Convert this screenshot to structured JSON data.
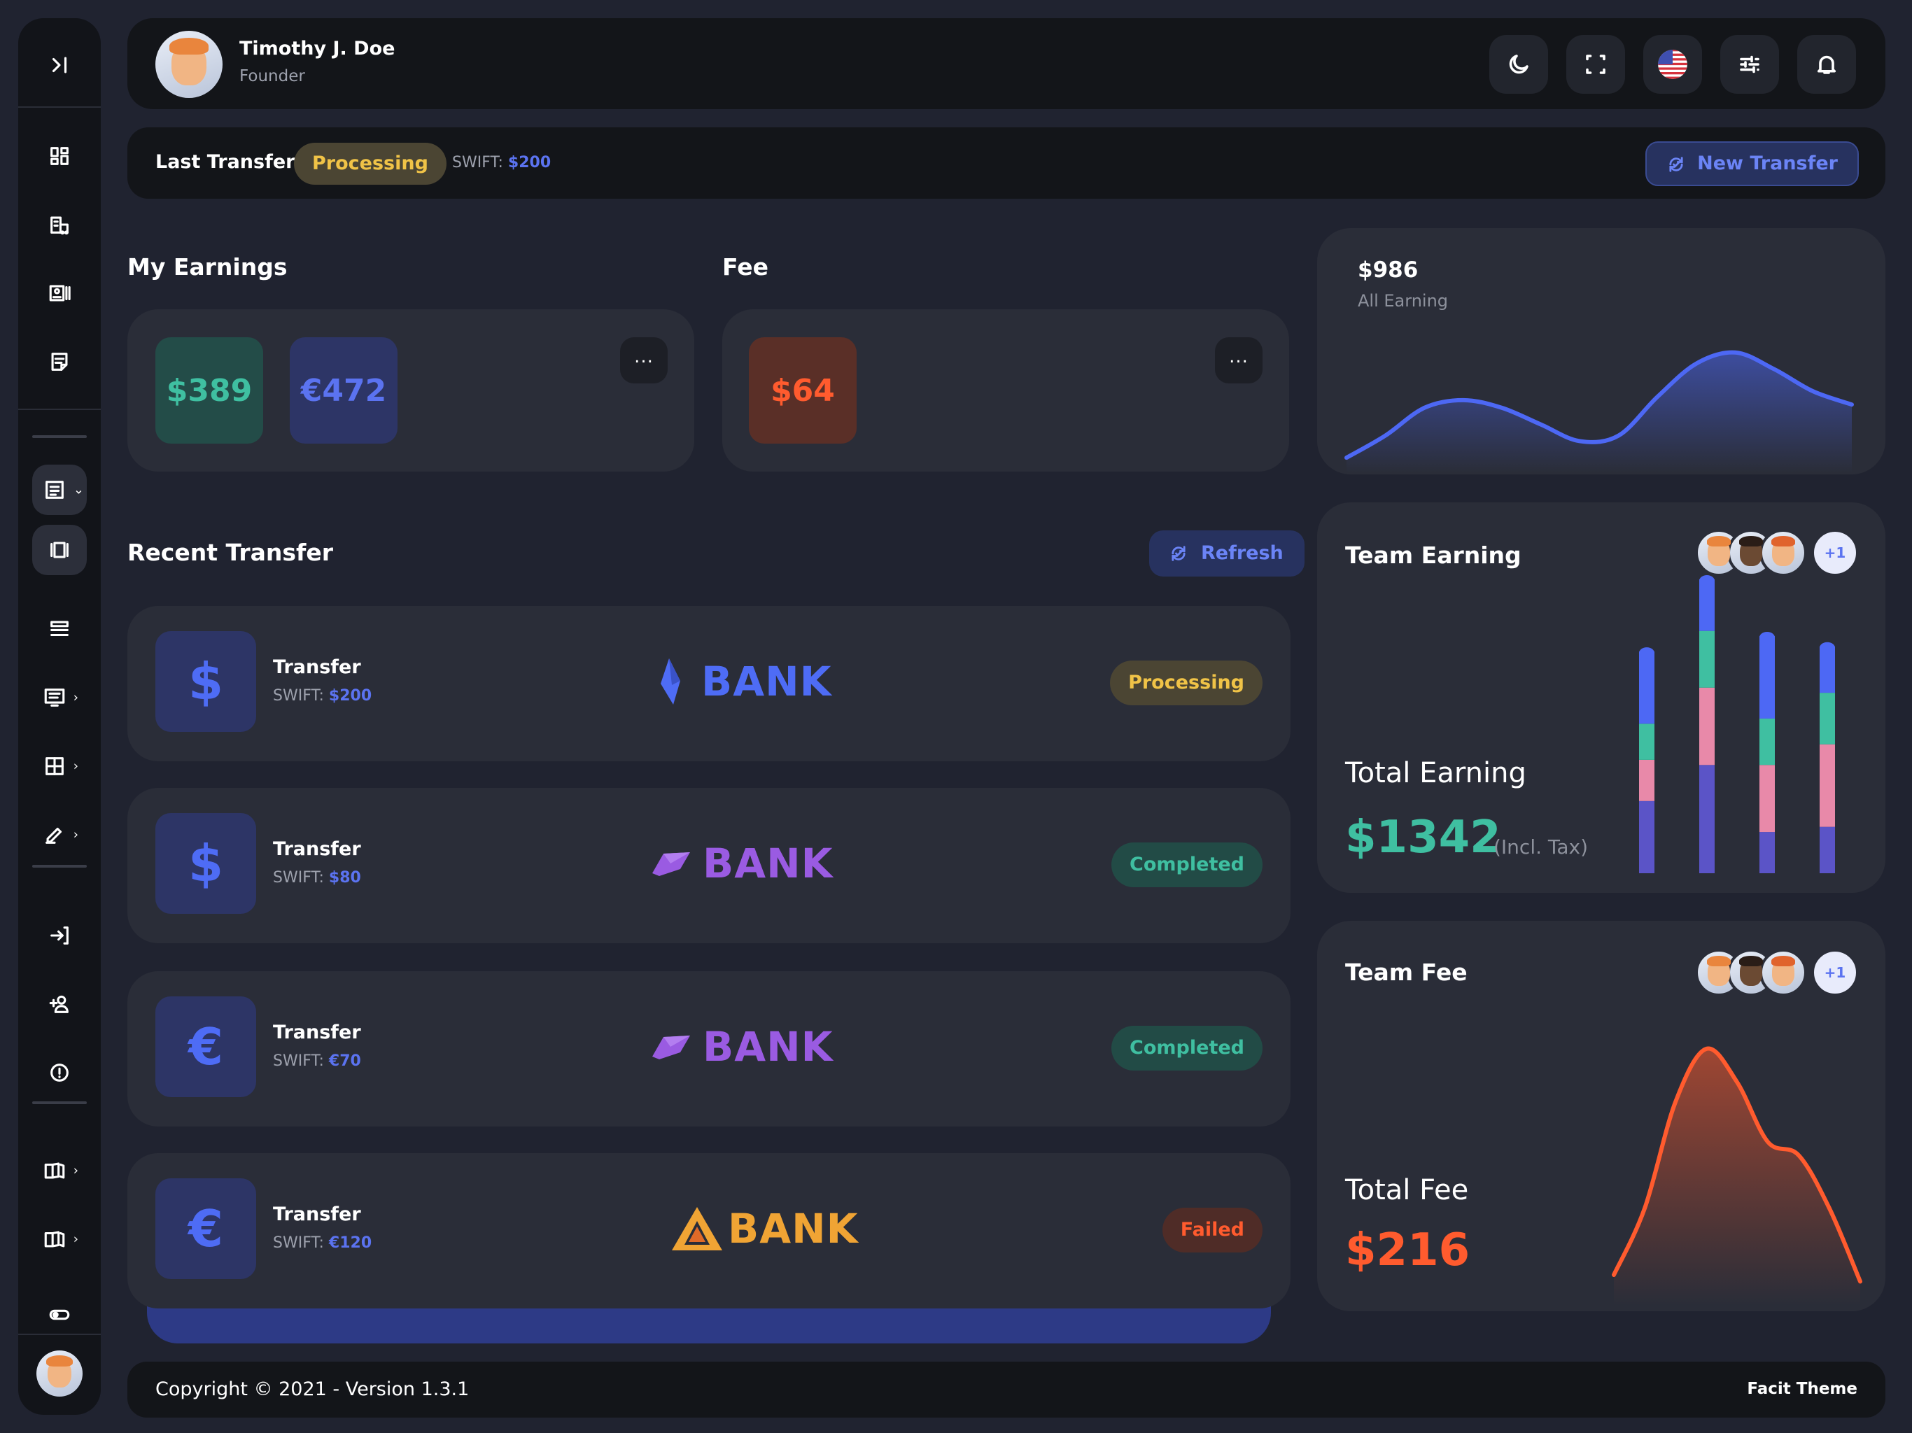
{
  "user": {
    "name": "Timothy J. Doe",
    "role": "Founder"
  },
  "last_transfer": {
    "label": "Last Transfer",
    "status": "Processing",
    "swift_label": "SWIFT:",
    "swift_value": "$200",
    "new_transfer_label": "New Transfer"
  },
  "earnings": {
    "title": "My Earnings",
    "usd": "$389",
    "eur": "€472",
    "more": "..."
  },
  "fee": {
    "title": "Fee",
    "value": "$64",
    "more": "..."
  },
  "all_earning": {
    "value": "$986",
    "label": "All Earning",
    "chart_data": {
      "type": "area",
      "values": [
        10,
        30,
        55,
        62,
        55,
        40,
        25,
        30,
        65,
        95,
        105,
        90,
        70,
        58
      ],
      "color": "#4d68f4"
    }
  },
  "recent": {
    "title": "Recent Transfer",
    "refresh_label": "Refresh",
    "items": [
      {
        "icon": "$",
        "name": "Transfer",
        "swift_label": "SWIFT:",
        "swift": "$200",
        "bank": "BANK",
        "bank_color": "#4e6cf5",
        "status": "Processing",
        "status_type": "proc",
        "logo": "crystal-logo"
      },
      {
        "icon": "$",
        "name": "Transfer",
        "swift_label": "SWIFT:",
        "swift": "$80",
        "bank": "BANK",
        "bank_color": "#9a5be2",
        "status": "Completed",
        "status_type": "comp",
        "logo": "gem-logo"
      },
      {
        "icon": "€",
        "name": "Transfer",
        "swift_label": "SWIFT:",
        "swift": "€70",
        "bank": "BANK",
        "bank_color": "#9a5be2",
        "status": "Completed",
        "status_type": "comp",
        "logo": "gem-logo"
      },
      {
        "icon": "€",
        "name": "Transfer",
        "swift_label": "SWIFT:",
        "swift": "€120",
        "bank": "BANK",
        "bank_color": "#f0a434",
        "status": "Failed",
        "status_type": "fail",
        "logo": "triangle-logo"
      }
    ]
  },
  "team_earning": {
    "title": "Team Earning",
    "more_count": "+1",
    "total_label": "Total Earning",
    "total_value": "$1342",
    "tax_note": "(Incl. Tax)",
    "chart_data": {
      "type": "bar",
      "stacked": true,
      "categories": [
        "1",
        "2",
        "3",
        "4"
      ],
      "series": [
        {
          "values": [
            70,
            105,
            40,
            45
          ],
          "color": "#5b54c7"
        },
        {
          "values": [
            40,
            75,
            65,
            80
          ],
          "color": "#e889a9"
        },
        {
          "values": [
            35,
            55,
            45,
            50
          ],
          "color": "#3fbfa1"
        },
        {
          "values": [
            70,
            50,
            80,
            45
          ],
          "color": "#4d68f4"
        }
      ]
    }
  },
  "team_fee": {
    "title": "Team Fee",
    "more_count": "+1",
    "total_label": "Total Fee",
    "total_value": "$216",
    "chart_data": {
      "type": "area",
      "values": [
        20,
        70,
        150,
        190,
        165,
        120,
        110,
        70,
        15
      ],
      "color": "#ff5b2e"
    }
  },
  "footer": {
    "copyright": "Copyright © 2021 - Version 1.3.1",
    "brand": "Facit Theme"
  }
}
